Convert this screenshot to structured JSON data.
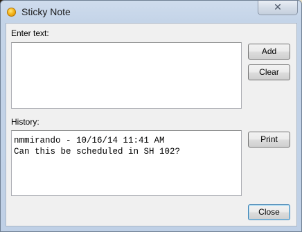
{
  "window": {
    "title": "Sticky Note",
    "close_glyph": "✕"
  },
  "input": {
    "label": "Enter text:",
    "value": ""
  },
  "buttons": {
    "add": "Add",
    "clear": "Clear",
    "print": "Print",
    "close": "Close"
  },
  "history": {
    "label": "History:",
    "lines": [
      "nmmirando - 10/16/14 11:41 AM",
      "Can this be scheduled in SH 102?"
    ]
  },
  "icons": {
    "app": "sticky-note-icon",
    "close": "close-icon"
  }
}
